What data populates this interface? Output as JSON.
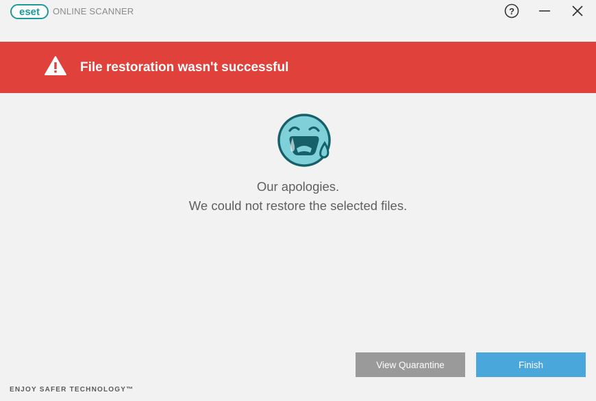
{
  "app": {
    "logo_text": "eset",
    "product_name": "ONLINE SCANNER"
  },
  "window_controls": {
    "help_symbol": "?",
    "icons": [
      "help-icon",
      "minimize-icon",
      "close-icon"
    ]
  },
  "banner": {
    "title": "File restoration wasn't successful",
    "icon": "warning-icon",
    "color": "#e0413a"
  },
  "message": {
    "icon": "crying-face-icon",
    "line1": "Our apologies.",
    "line2": "We could not restore the selected files."
  },
  "actions": {
    "view_quarantine_label": "View Quarantine",
    "finish_label": "Finish",
    "quarantine_color": "#9a9a9a",
    "finish_color": "#4aa7dc"
  },
  "footer": {
    "tagline": "ENJOY SAFER TECHNOLOGY™"
  }
}
